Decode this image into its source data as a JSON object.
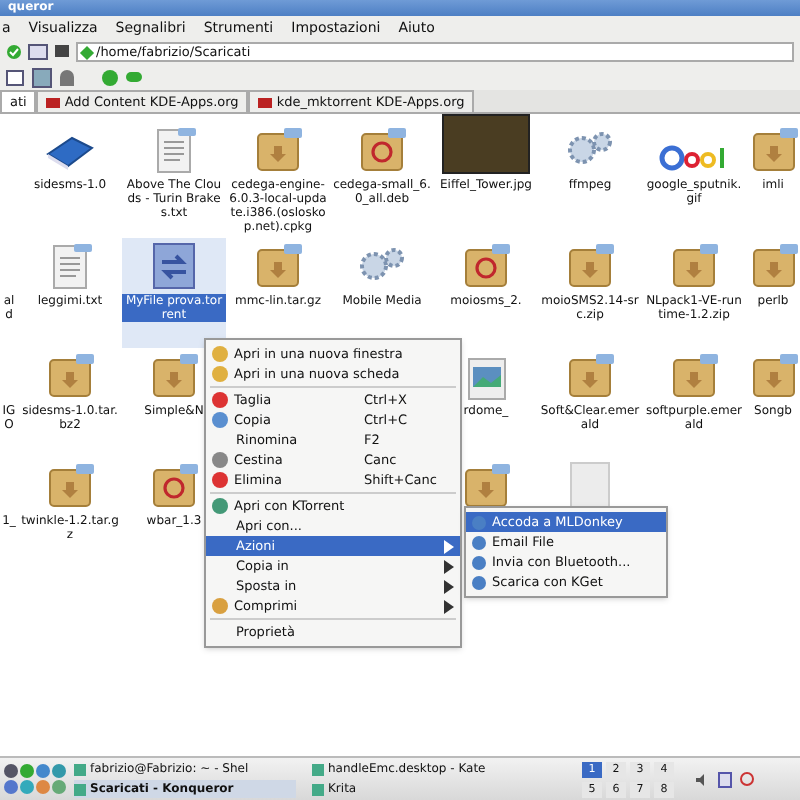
{
  "window": {
    "title": "queror"
  },
  "menubar": [
    "a",
    "Visualizza",
    "Segnalibri",
    "Strumenti",
    "Impostazioni",
    "Aiuto"
  ],
  "location": {
    "value": "/home/fabrizio/Scaricati"
  },
  "tabs": [
    {
      "label": "ati",
      "selected": true
    },
    {
      "label": "Add Content KDE-Apps.org",
      "selected": false
    },
    {
      "label": "kde_mktorrent KDE-Apps.org",
      "selected": false
    }
  ],
  "files": [
    {
      "kind": "none"
    },
    {
      "name": "sidesms-1.0",
      "kind": "book",
      "selected": false
    },
    {
      "name": "Above The Clouds - Turin Brakes.txt",
      "kind": "text",
      "selected": false
    },
    {
      "name": "cedega-engine-6.0.3-local-update.i386.(osloskop.net).cpkg",
      "kind": "package",
      "selected": false
    },
    {
      "name": "cedega-small_6.0_all.deb",
      "kind": "debian",
      "selected": false
    },
    {
      "name": "Eiffel_Tower.jpg",
      "kind": "photo",
      "selected": false
    },
    {
      "name": "ffmpeg",
      "kind": "gear",
      "selected": false
    },
    {
      "name": "google_sputnik.gif",
      "kind": "google",
      "selected": false
    },
    {
      "name": "imli",
      "kind": "package",
      "selected": false
    },
    {
      "name": "ald",
      "kind": "label",
      "selected": false
    },
    {
      "name": "leggimi.txt",
      "kind": "text",
      "selected": false
    },
    {
      "name": "MyFile prova.torrent",
      "kind": "torrent",
      "selected": true
    },
    {
      "name": "mmc-lin.tar.gz",
      "kind": "package",
      "selected": false
    },
    {
      "name": "Mobile Media",
      "kind": "gear",
      "selected": false
    },
    {
      "name": "moiosms_2.",
      "kind": "debian",
      "selected": false
    },
    {
      "name": "moioSMS2.14-src.zip",
      "kind": "package",
      "selected": false
    },
    {
      "name": "NLpack1-VE-runtime-1.2.zip",
      "kind": "package",
      "selected": false
    },
    {
      "name": "perlb",
      "kind": "package",
      "selected": false
    },
    {
      "name": "IGO",
      "kind": "label",
      "selected": false
    },
    {
      "name": "sidesms-1.0.tar.bz2",
      "kind": "package",
      "selected": false
    },
    {
      "name": "Simple&N",
      "kind": "package",
      "selected": false
    },
    {
      "kind": "none"
    },
    {
      "kind": "none"
    },
    {
      "name": "rdome_",
      "kind": "image",
      "selected": false
    },
    {
      "name": "Soft&Clear.emerald",
      "kind": "package",
      "selected": false
    },
    {
      "name": "softpurple.emerald",
      "kind": "package",
      "selected": false
    },
    {
      "name": "Songb",
      "kind": "package",
      "selected": false
    },
    {
      "name": "1_",
      "kind": "label",
      "selected": false
    },
    {
      "name": "twinkle-1.2.tar.gz",
      "kind": "package",
      "selected": false
    },
    {
      "name": "wbar_1.3",
      "kind": "debian",
      "selected": false
    },
    {
      "kind": "none"
    },
    {
      "kind": "none"
    },
    {
      "kind": "package",
      "selected": false
    },
    {
      "kind": "blank",
      "selected": false
    }
  ],
  "context_menu": {
    "items": [
      {
        "kind": "item",
        "label": "Apri in una nuova finestra",
        "selected": false
      },
      {
        "kind": "item",
        "label": "Apri in una nuova scheda",
        "selected": false
      },
      {
        "kind": "separator"
      },
      {
        "kind": "item",
        "label": "Taglia",
        "shortcut": "Ctrl+X",
        "selected": false
      },
      {
        "kind": "item",
        "label": "Copia",
        "shortcut": "Ctrl+C",
        "selected": false
      },
      {
        "kind": "item",
        "label": "Rinomina",
        "shortcut": "F2",
        "selected": false
      },
      {
        "kind": "item",
        "label": "Cestina",
        "shortcut": "Canc",
        "selected": false
      },
      {
        "kind": "item",
        "label": "Elimina",
        "shortcut": "Shift+Canc",
        "selected": false
      },
      {
        "kind": "separator"
      },
      {
        "kind": "item",
        "label": "Apri con KTorrent",
        "selected": false
      },
      {
        "kind": "item",
        "label": "Apri con...",
        "selected": false
      },
      {
        "kind": "submenu",
        "label": "Azioni",
        "selected": true
      },
      {
        "kind": "submenu",
        "label": "Copia in",
        "selected": false
      },
      {
        "kind": "submenu",
        "label": "Sposta in",
        "selected": false
      },
      {
        "kind": "submenu",
        "label": "Comprimi",
        "selected": false
      },
      {
        "kind": "separator"
      },
      {
        "kind": "item",
        "label": "Proprietà",
        "selected": false
      }
    ]
  },
  "submenu": {
    "items": [
      {
        "label": "Accoda a MLDonkey",
        "selected": true
      },
      {
        "label": "Email File",
        "selected": false
      },
      {
        "label": "Invia con Bluetooth...",
        "selected": false
      },
      {
        "label": "Scarica con KGet",
        "selected": false
      }
    ]
  },
  "taskbar": {
    "tasks": [
      {
        "label": "fabrizio@Fabrizio: ~ - Shel",
        "active": false
      },
      {
        "label": "handleEmc.desktop - Kate",
        "active": false
      },
      {
        "label": "Scaricati - Konqueror",
        "active": true
      },
      {
        "label": "Krita",
        "active": false
      }
    ],
    "desktops": [
      {
        "label": "1",
        "selected": true
      },
      {
        "label": "2",
        "selected": false
      },
      {
        "label": "3",
        "selected": false
      },
      {
        "label": "4",
        "selected": false
      },
      {
        "label": "5",
        "selected": false
      },
      {
        "label": "6",
        "selected": false
      },
      {
        "label": "7",
        "selected": false
      },
      {
        "label": "8",
        "selected": false
      }
    ]
  }
}
